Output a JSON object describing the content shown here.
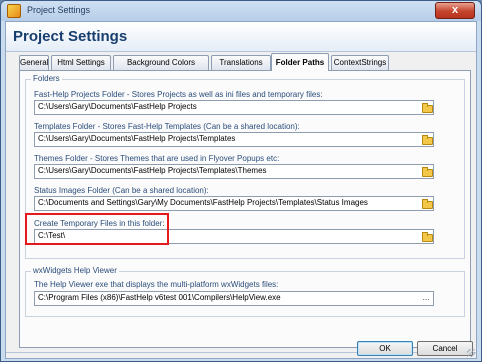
{
  "window": {
    "title": "Project Settings",
    "close_label": "x"
  },
  "header": {
    "title": "Project Settings"
  },
  "tabs": [
    {
      "label": "General"
    },
    {
      "label": "Html Settings"
    },
    {
      "label": "Background Colors"
    },
    {
      "label": "Translations"
    },
    {
      "label": "Folder Paths"
    },
    {
      "label": "ContextStrings"
    }
  ],
  "active_tab": "Folder Paths",
  "folders_group": {
    "title": "Folders",
    "fields": [
      {
        "label": "Fast-Help Projects Folder - Stores Projects as well as ini files and temporary files:",
        "value": "C:\\Users\\Gary\\Documents\\FastHelp Projects"
      },
      {
        "label": "Templates Folder - Stores Fast-Help Templates (Can be a shared location):",
        "value": "C:\\Users\\Gary\\Documents\\FastHelp Projects\\Templates"
      },
      {
        "label": "Themes Folder - Stores Themes that are used in Flyover Popups etc:",
        "value": "C:\\Users\\Gary\\Documents\\FastHelp Projects\\Templates\\Themes"
      },
      {
        "label": "Status Images Folder (Can be a shared location):",
        "value": "C:\\Documents and Settings\\Gary\\My Documents\\FastHelp Projects\\Templates\\Status Images"
      },
      {
        "label": "Create Temporary Files in this folder:",
        "value": "C:\\Test\\"
      }
    ]
  },
  "wx_group": {
    "title": "wxWidgets Help Viewer",
    "label": "The Help Viewer exe that displays the multi-platform wxWidgets files:",
    "value": "C:\\Program Files (x86)\\FastHelp v6test 001\\Compilers\\HelpView.exe",
    "button_label": "..."
  },
  "buttons": {
    "ok": "OK",
    "cancel": "Cancel"
  },
  "icons": {
    "folder": "folder-icon",
    "app": "app-icon"
  },
  "colors": {
    "accent": "#183e6e",
    "highlight": "#e5181e"
  }
}
